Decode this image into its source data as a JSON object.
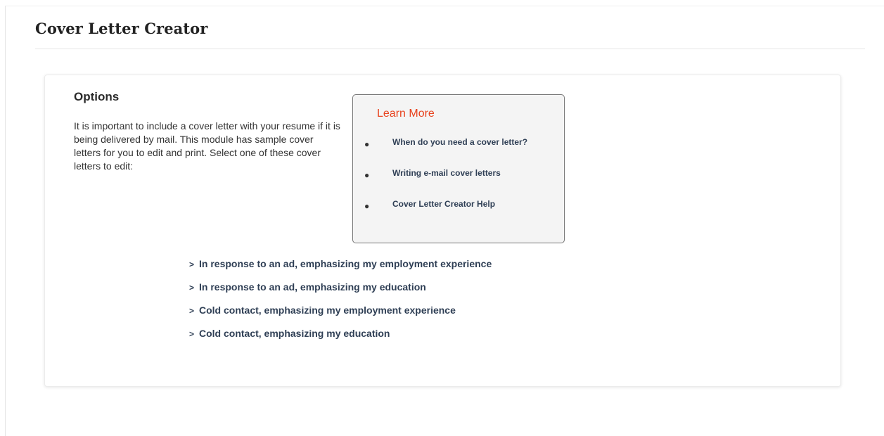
{
  "page": {
    "title": "Cover Letter Creator"
  },
  "options": {
    "heading": "Options",
    "intro": "It is important to include a cover letter with your resume if it is being delivered by mail. This module has sample cover letters for you to edit and print. Select one of these cover letters to edit:"
  },
  "learn_more": {
    "heading": "Learn More",
    "links": [
      {
        "label": "When do you need a cover letter?"
      },
      {
        "label": "Writing e-mail cover letters"
      },
      {
        "label": "Cover Letter Creator Help"
      }
    ]
  },
  "cover_letters": [
    {
      "label": "In response to an ad, emphasizing my employment experience"
    },
    {
      "label": "In response to an ad, emphasizing my education"
    },
    {
      "label": "Cold contact, emphasizing my employment experience"
    },
    {
      "label": "Cold contact, emphasizing my education"
    }
  ],
  "icons": {
    "bullet": "bullet-dot-icon",
    "chevron": "chevron-right-icon"
  },
  "colors": {
    "learn_more_heading": "#e8431f",
    "link": "#2f3f55",
    "learn_more_background": "#f4f4f4"
  }
}
